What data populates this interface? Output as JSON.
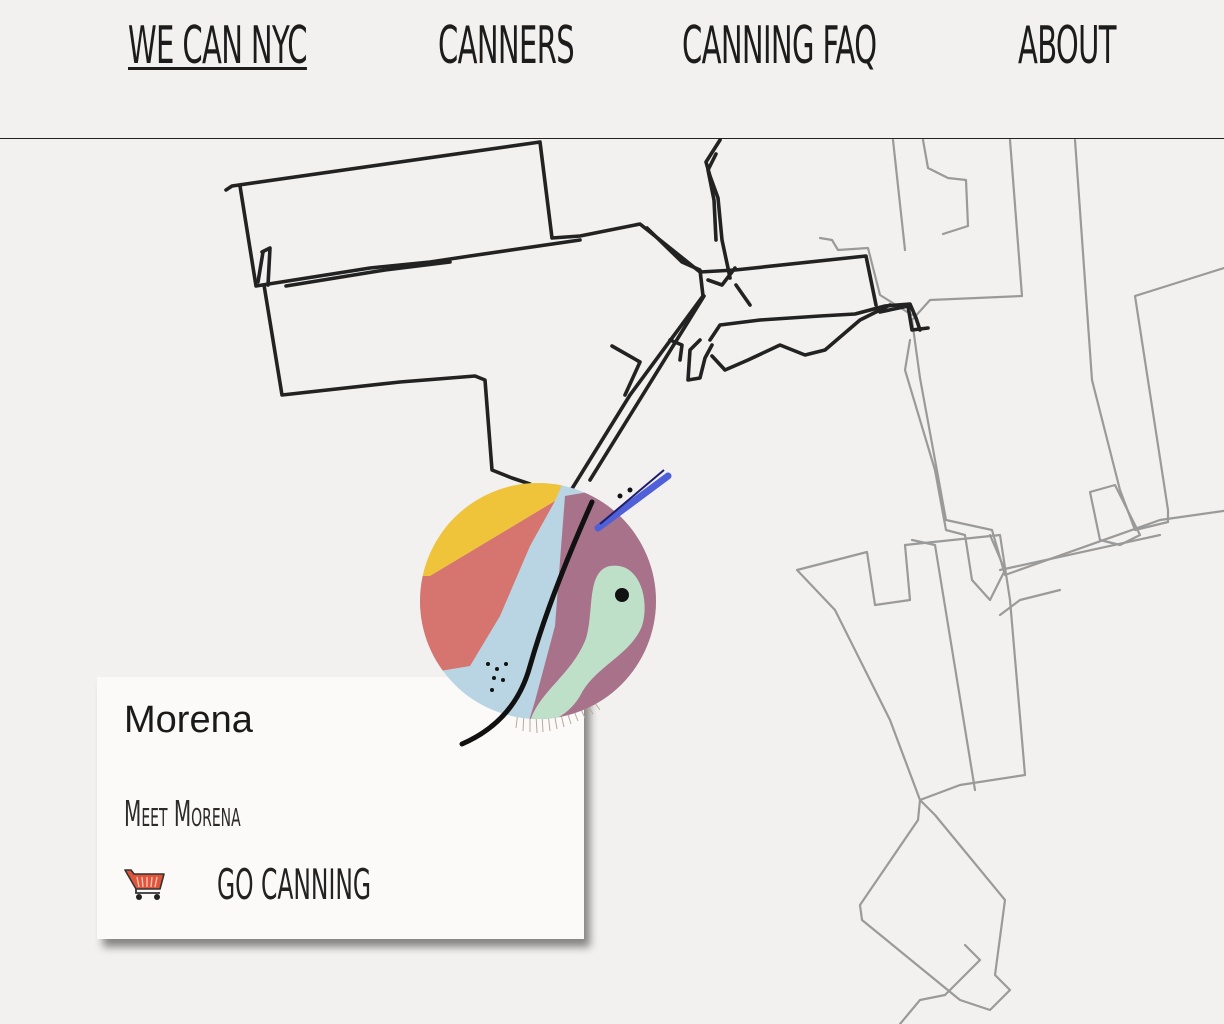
{
  "nav": {
    "items": [
      {
        "label": "WE CAN NYC",
        "active": true
      },
      {
        "label": "CANNERS",
        "active": false
      },
      {
        "label": "CANNING FAQ",
        "active": false
      },
      {
        "label": "ABOUT",
        "active": false
      }
    ]
  },
  "popup": {
    "title": "Morena",
    "meet_link": "Meet Morena",
    "go_canning": "GO CANNING",
    "cart_icon": "shopping-cart-icon"
  },
  "colors": {
    "background": "#f3f1ef",
    "route_primary": "#222222",
    "route_secondary": "#9a9a9a",
    "cart": "#e0553a",
    "marker_yellow": "#f0c43a",
    "marker_red": "#d9665f",
    "marker_blue": "#b9d4e2",
    "marker_purple": "#a8728a",
    "marker_green": "#bfe0c8",
    "marker_stripe": "#5060d8"
  }
}
